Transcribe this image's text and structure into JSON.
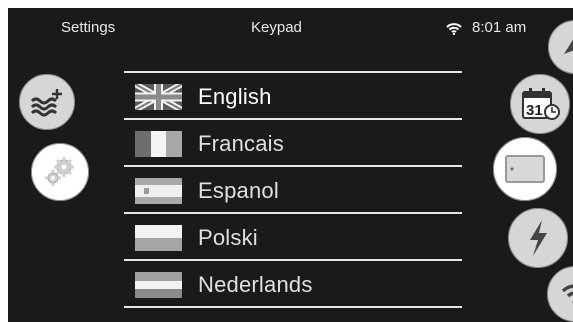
{
  "status_bar": {
    "settings_label": "Settings",
    "title": "Keypad",
    "time": "8:01 am",
    "wifi_icon": "wifi-icon"
  },
  "left_buttons": [
    {
      "name": "water-heat-button",
      "icon": "water-plus-icon"
    },
    {
      "name": "settings-gear-button",
      "icon": "gears-icon"
    }
  ],
  "right_buttons": [
    {
      "name": "top-edge-button",
      "icon": "arrow-icon"
    },
    {
      "name": "calendar-button",
      "icon": "calendar-clock-icon",
      "day": "31"
    },
    {
      "name": "keypad-button",
      "icon": "keypad-icon"
    },
    {
      "name": "power-button",
      "icon": "lightning-icon"
    },
    {
      "name": "wifi-button",
      "icon": "wifi-icon"
    }
  ],
  "languages": [
    {
      "label": "English",
      "flag": "uk-flag-icon",
      "selected": true
    },
    {
      "label": "Francais",
      "flag": "france-flag-icon",
      "selected": false
    },
    {
      "label": "Espanol",
      "flag": "spain-flag-icon",
      "selected": false
    },
    {
      "label": "Polski",
      "flag": "poland-flag-icon",
      "selected": false
    },
    {
      "label": "Nederlands",
      "flag": "netherlands-flag-icon",
      "selected": false
    }
  ],
  "colors": {
    "background": "#1a1a1a",
    "button_fill": "#d6d6d6",
    "divider": "#e6e6e6",
    "text": "#e0e0e0"
  }
}
